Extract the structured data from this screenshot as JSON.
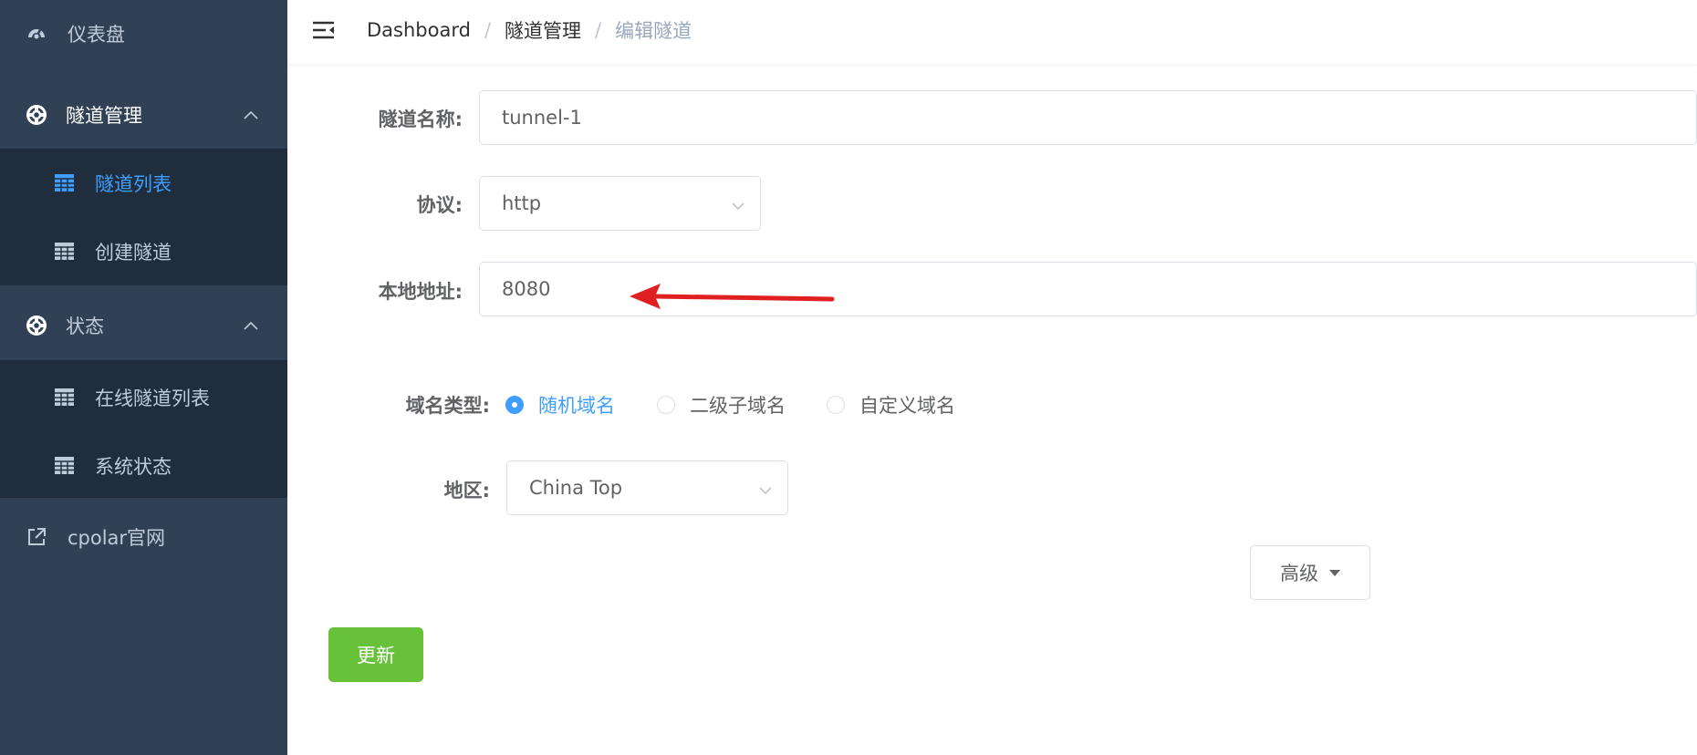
{
  "sidebar": {
    "dashboard": "仪表盘",
    "tunnel_mgmt": "隧道管理",
    "tunnel_list": "隧道列表",
    "create_tunnel": "创建隧道",
    "status": "状态",
    "online_tunnels": "在线隧道列表",
    "system_status": "系统状态",
    "cpolar_site": "cpolar官网"
  },
  "breadcrumb": {
    "items": [
      "Dashboard",
      "隧道管理",
      "编辑隧道"
    ],
    "separator": "/"
  },
  "form": {
    "name_label": "隧道名称:",
    "name_value": "tunnel-1",
    "protocol_label": "协议:",
    "protocol_value": "http",
    "local_addr_label": "本地地址:",
    "local_addr_value": "8080",
    "domain_type_label": "域名类型:",
    "domain_options": [
      "随机域名",
      "二级子域名",
      "自定义域名"
    ],
    "domain_selected": "随机域名",
    "region_label": "地区:",
    "region_value": "China Top",
    "advanced_label": "高级",
    "update_label": "更新"
  },
  "colors": {
    "sidebar_bg": "#304156",
    "submenu_bg": "#1f2d3d",
    "active": "#409eff",
    "success": "#67c23a",
    "annotation_arrow": "#e02020"
  },
  "icons": {
    "dashboard": "dashboard-icon",
    "tunnel": "lifebuoy-icon",
    "list": "grid-icon",
    "external": "external-link-icon",
    "menu_toggle": "hamburger-icon",
    "dropdown": "chevron-down-icon"
  }
}
